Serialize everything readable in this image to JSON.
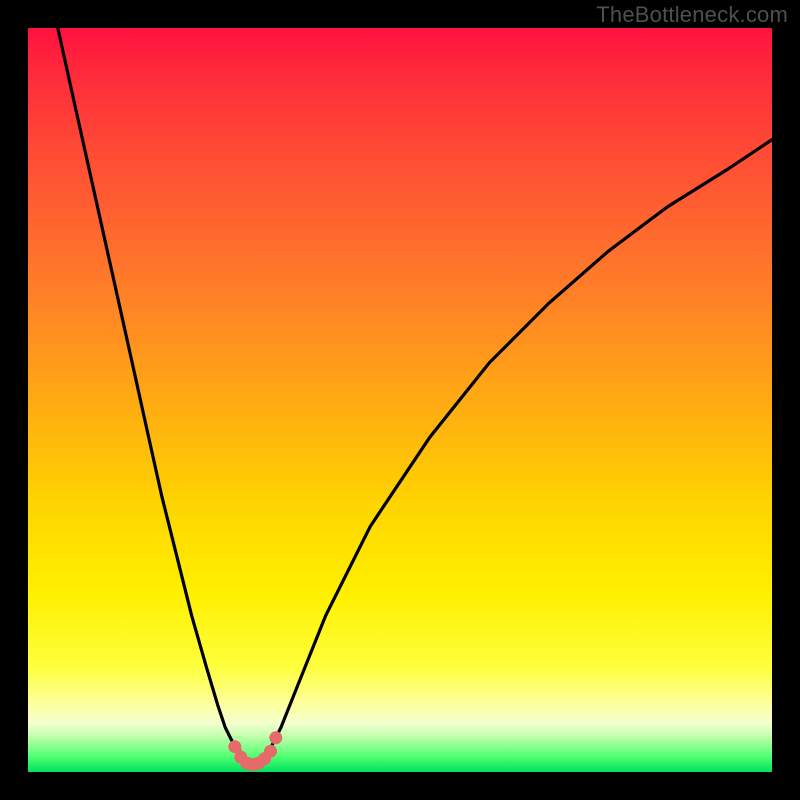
{
  "watermark": "TheBottleneck.com",
  "chart_data": {
    "type": "line",
    "title": "",
    "xlabel": "",
    "ylabel": "",
    "xlim": [
      0,
      100
    ],
    "ylim": [
      0,
      100
    ],
    "series": [
      {
        "name": "left-branch",
        "x": [
          4,
          6,
          8,
          10,
          12,
          14,
          16,
          18,
          20,
          22,
          24,
          25.5,
          26.5,
          27.5,
          28.2
        ],
        "values": [
          100,
          91,
          82,
          73,
          64,
          55,
          46,
          37,
          29,
          21,
          14,
          9,
          6,
          4,
          3
        ]
      },
      {
        "name": "right-branch",
        "x": [
          32.5,
          34,
          36,
          40,
          46,
          54,
          62,
          70,
          78,
          86,
          94,
          100
        ],
        "values": [
          3,
          6,
          11,
          21,
          33,
          45,
          55,
          63,
          70,
          76,
          81,
          85
        ]
      },
      {
        "name": "valley-floor",
        "x": [
          28.2,
          28.8,
          29.6,
          30.4,
          31.2,
          32.0,
          32.5
        ],
        "values": [
          3,
          1.6,
          1.0,
          1.0,
          1.2,
          2.0,
          3
        ]
      }
    ],
    "markers": {
      "name": "valley-points",
      "color": "#e76a6a",
      "x": [
        27.8,
        28.6,
        29.4,
        30.2,
        31.0,
        31.8,
        32.6,
        33.3
      ],
      "values": [
        3.4,
        2.0,
        1.2,
        1.0,
        1.2,
        1.8,
        2.8,
        4.6
      ]
    }
  }
}
